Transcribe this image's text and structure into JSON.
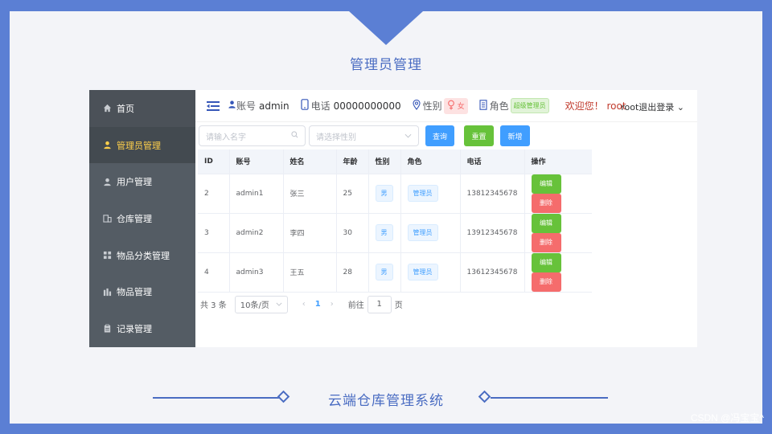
{
  "slide": {
    "title": "管理员管理",
    "footer": "云端仓库管理系统",
    "watermark": "CSDN @冯宝宝^"
  },
  "sidebar": {
    "items": [
      {
        "label": "首页",
        "icon": "home-icon"
      },
      {
        "label": "管理员管理",
        "icon": "user-icon",
        "active": true
      },
      {
        "label": "用户管理",
        "icon": "user-icon"
      },
      {
        "label": "仓库管理",
        "icon": "warehouse-icon"
      },
      {
        "label": "物品分类管理",
        "icon": "grid-icon"
      },
      {
        "label": "物品管理",
        "icon": "chart-icon"
      },
      {
        "label": "记录管理",
        "icon": "clipboard-icon"
      }
    ]
  },
  "header": {
    "account_label": "账号",
    "account_value": "admin",
    "phone_label": "电话",
    "phone_value": "00000000000",
    "gender_label": "性别",
    "gender_value": "女",
    "role_label": "角色",
    "role_value": "超级管理员",
    "welcome": "欢迎您！ root",
    "logout": "root退出登录"
  },
  "toolbar": {
    "name_placeholder": "请输入名字",
    "gender_placeholder": "请选择性别",
    "query": "查询",
    "reset": "重置",
    "add": "新增"
  },
  "table": {
    "headers": [
      "ID",
      "账号",
      "姓名",
      "年龄",
      "性别",
      "角色",
      "电话",
      "操作"
    ],
    "rows": [
      {
        "id": "2",
        "account": "admin1",
        "name": "张三",
        "age": "25",
        "gender": "男",
        "role": "管理员",
        "phone": "13812345678"
      },
      {
        "id": "3",
        "account": "admin2",
        "name": "李四",
        "age": "30",
        "gender": "男",
        "role": "管理员",
        "phone": "13912345678"
      },
      {
        "id": "4",
        "account": "admin3",
        "name": "王五",
        "age": "28",
        "gender": "男",
        "role": "管理员",
        "phone": "13612345678"
      }
    ],
    "edit_label": "编辑",
    "delete_label": "删除"
  },
  "pager": {
    "total": "共 3 条",
    "page_size": "10条/页",
    "current": "1",
    "goto_prefix": "前往",
    "goto_value": "1",
    "goto_suffix": "页"
  },
  "colors": {
    "background": "#5b7fd4",
    "sidebar": "#545c64",
    "active": "#ffd04b",
    "primary": "#409eff",
    "success": "#67c23a",
    "danger": "#f56c6c"
  }
}
